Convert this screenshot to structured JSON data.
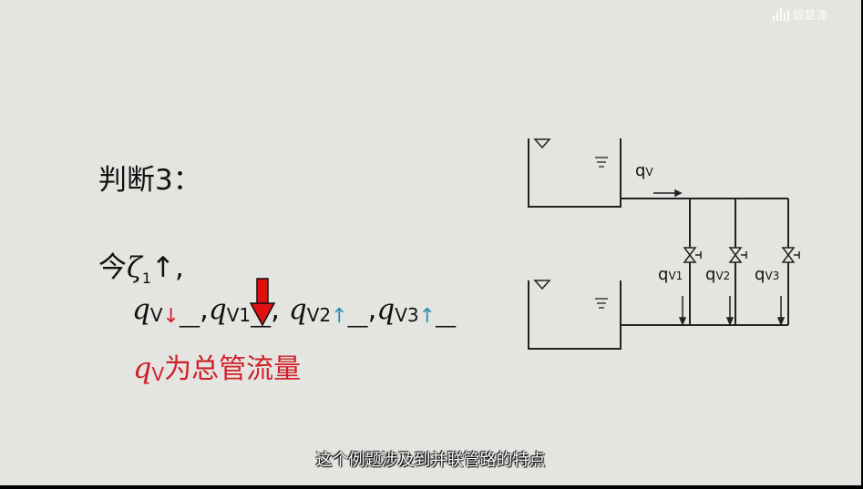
{
  "watermark": {
    "icon": "sound-bars-icon",
    "text": "超慧课"
  },
  "slide": {
    "heading": "判断3：",
    "condition": {
      "prefix": "今",
      "symbol": "ζ",
      "subscript": "1",
      "arrow": "↑",
      "suffix": ","
    },
    "answers": [
      {
        "q": "q",
        "sub": "V",
        "arrow": "↓",
        "arrow_color": "#d0202a",
        "blank": "__",
        "sep": ","
      },
      {
        "q": "q",
        "sub": "V1",
        "arrow": "",
        "arrow_color": "",
        "blank": "__",
        "sep": ","
      },
      {
        "q": "q",
        "sub": "V2",
        "arrow": "↑",
        "arrow_color": "#2a8fb0",
        "blank": "__",
        "sep": ","
      },
      {
        "q": "q",
        "sub": "V3",
        "arrow": "↑",
        "arrow_color": "#2a8fb0",
        "blank": "__",
        "sep": ""
      }
    ],
    "note": {
      "q": "q",
      "sub": "V",
      "text": "为总管流量"
    },
    "pointer": {
      "icon": "red-down-arrow-icon",
      "color": "#e01010"
    }
  },
  "diagram": {
    "main_flow": {
      "q": "q",
      "sub": "V"
    },
    "branches": [
      {
        "q": "q",
        "sub": "V1"
      },
      {
        "q": "q",
        "sub": "V2"
      },
      {
        "q": "q",
        "sub": "V3"
      }
    ]
  },
  "caption": "这个例题涉及到并联管路的特点"
}
